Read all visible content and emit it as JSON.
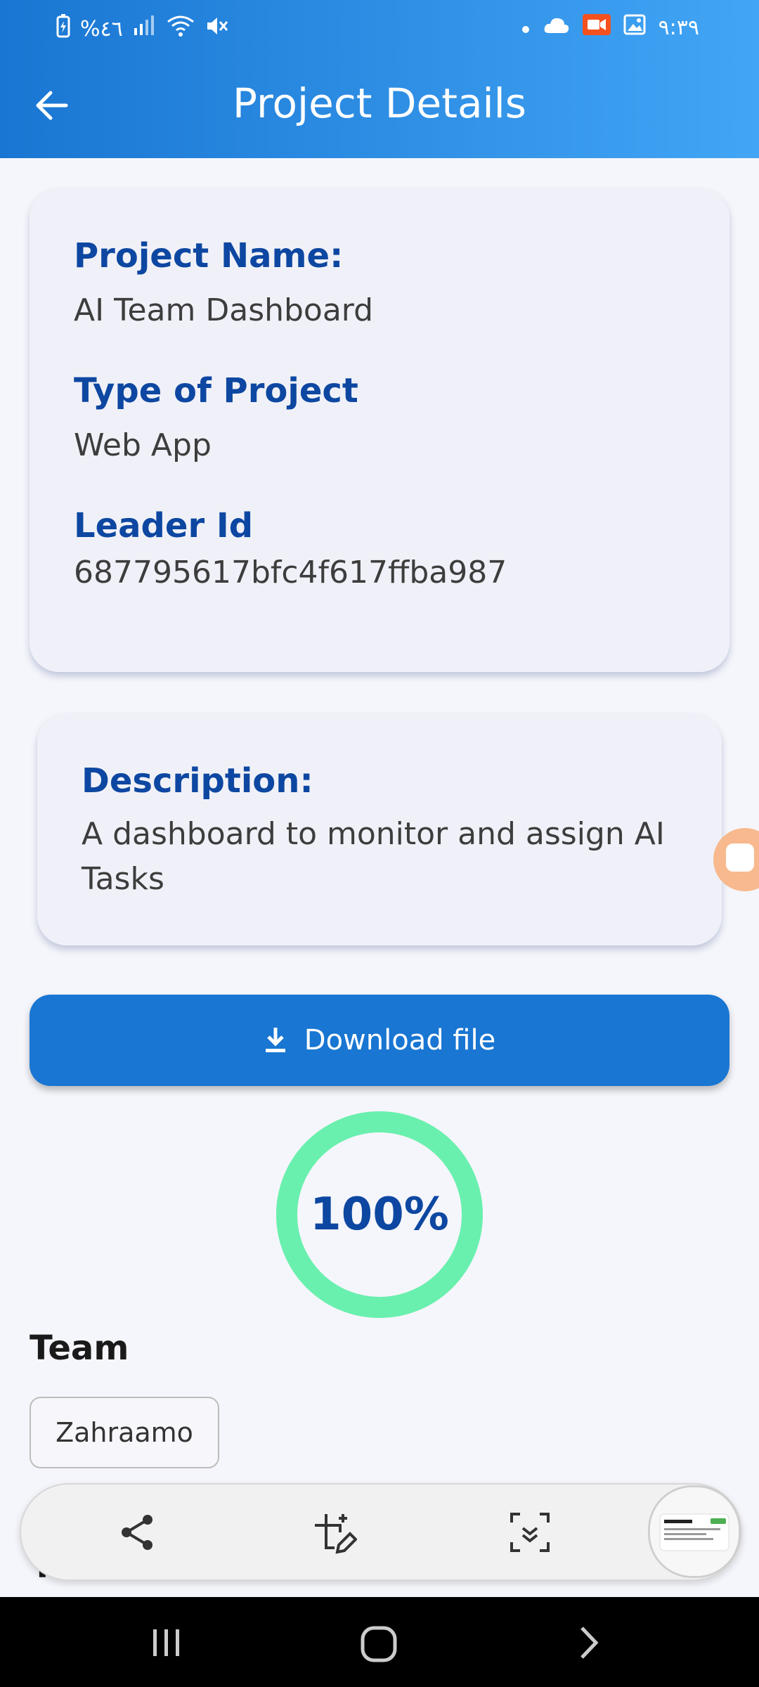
{
  "status_bar": {
    "battery": "%٤٦",
    "time": "٩:٣٩"
  },
  "header": {
    "title": "Project Details"
  },
  "project_card": {
    "name_label": "Project Name:",
    "name_value": "AI Team Dashboard",
    "type_label": "Type of Project",
    "type_value": "Web App",
    "leader_label": "Leader Id",
    "leader_value": "687795617bfc4f617ffba987"
  },
  "description_card": {
    "label": "Description:",
    "value": "A dashboard to monitor and assign AI Tasks"
  },
  "download": {
    "label": "Download file"
  },
  "progress": {
    "text": "100%",
    "fraction": 1.0,
    "color": "#69f0ae"
  },
  "team": {
    "title": "Team",
    "members": [
      "Zahraamo"
    ]
  },
  "tasks": {
    "title": "Tasks"
  },
  "screenshot_toolbar": {
    "items": [
      "share-icon",
      "crop-edit-icon",
      "scroll-capture-icon"
    ]
  },
  "colors": {
    "appbar_start": "#1976d2",
    "appbar_end": "#42a5f5",
    "label_blue": "#0d47a1",
    "button_blue": "#1976d2"
  }
}
